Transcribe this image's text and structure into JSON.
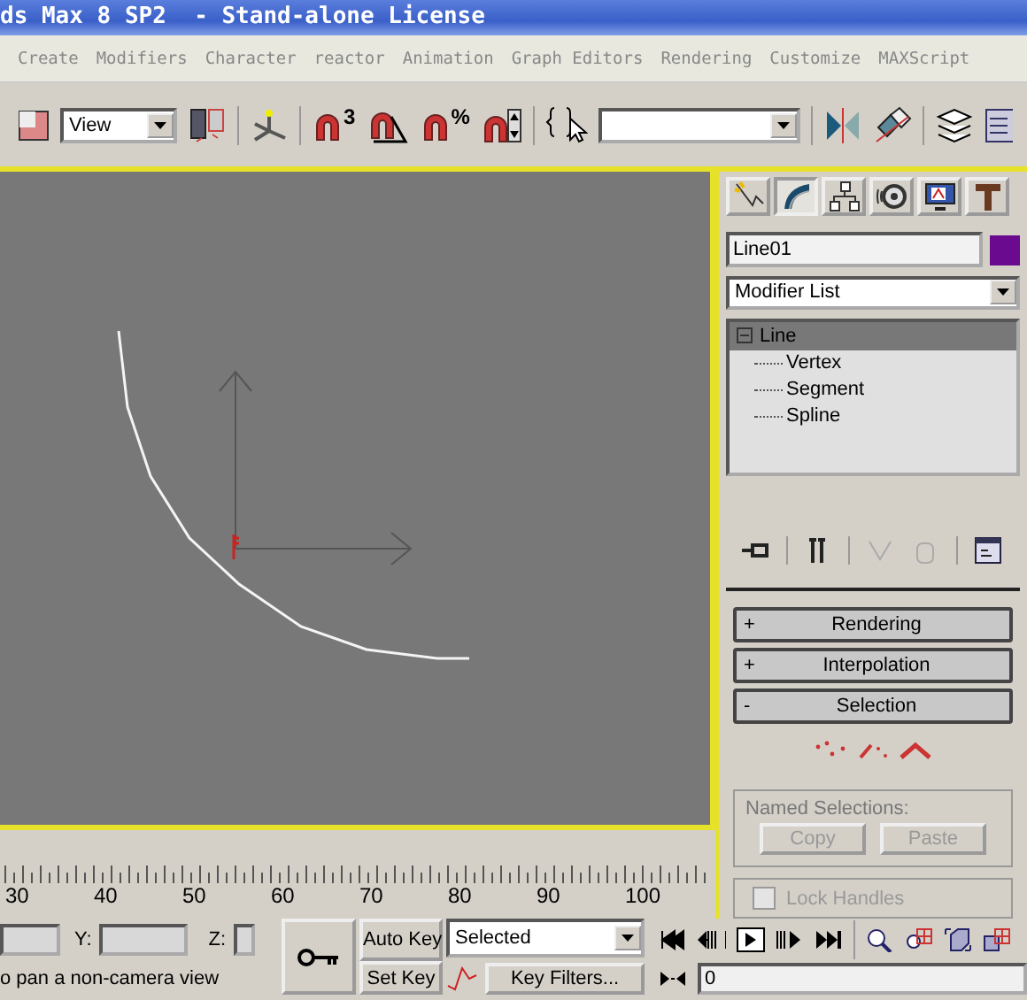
{
  "window": {
    "title": "ds Max 8 SP2  - Stand-alone License"
  },
  "menu": [
    "Create",
    "Modifiers",
    "Character",
    "reactor",
    "Animation",
    "Graph Editors",
    "Rendering",
    "Customize",
    "MAXScript"
  ],
  "toolbar": [
    {
      "kind": "select"
    },
    {
      "kind": "dropdown",
      "label": "View"
    },
    {
      "kind": "cards"
    },
    {
      "kind": "sep"
    },
    {
      "kind": "axes"
    },
    {
      "kind": "sep"
    },
    {
      "kind": "magnet",
      "glyph": "3"
    },
    {
      "kind": "angle"
    },
    {
      "kind": "magnet",
      "glyph": "%"
    },
    {
      "kind": "spinner"
    },
    {
      "kind": "sep"
    },
    {
      "kind": "braces"
    },
    {
      "kind": "dropdown"
    },
    {
      "kind": "sep"
    },
    {
      "kind": "mirror"
    },
    {
      "kind": "align"
    },
    {
      "kind": "sep"
    },
    {
      "kind": "layers"
    },
    {
      "kind": "panel"
    }
  ],
  "command_panel": {
    "tabs": [
      {
        "kind": "create",
        "selected": false
      },
      {
        "kind": "modify",
        "selected": true
      },
      {
        "kind": "hierarchy",
        "selected": false
      },
      {
        "kind": "motion",
        "selected": false
      },
      {
        "kind": "display",
        "selected": false
      },
      {
        "kind": "utilities",
        "selected": false
      }
    ],
    "object_name": "Line01",
    "modifier_list": "Modifier List",
    "stack": [
      {
        "label": "Line",
        "expanded": true,
        "selected": true,
        "children": [
          {
            "label": "Vertex"
          },
          {
            "label": "Segment"
          },
          {
            "label": "Spline"
          }
        ]
      }
    ],
    "stack_tools": [
      {
        "kind": "pin",
        "disabled": false
      },
      {
        "kind": "sep"
      },
      {
        "kind": "result",
        "disabled": false
      },
      {
        "kind": "sep"
      },
      {
        "kind": "unique",
        "disabled": true
      },
      {
        "kind": "remove",
        "disabled": true
      },
      {
        "kind": "sep"
      },
      {
        "kind": "configure",
        "disabled": false
      }
    ],
    "rollouts": [
      {
        "sign": "+",
        "title": "Rendering"
      },
      {
        "sign": "+",
        "title": "Interpolation"
      },
      {
        "sign": "-",
        "title": "Selection"
      }
    ],
    "selection": {
      "levels": [
        {
          "kind": "vertex",
          "selected": false
        },
        {
          "kind": "segment",
          "selected": false
        },
        {
          "kind": "spline",
          "selected": false
        }
      ],
      "named_selections": {
        "title": "Named Selections:",
        "buttons": [
          {
            "label": "Copy",
            "disabled": true
          },
          {
            "label": "Paste",
            "disabled": true
          }
        ]
      },
      "lock_handles": {
        "label": "Lock Handles",
        "checked": false,
        "disabled": true
      }
    }
  },
  "timeline": {
    "ticks": [
      "30",
      "40",
      "50",
      "60",
      "70",
      "80",
      "90",
      "100"
    ]
  },
  "coordinates": [
    {
      "label": "Y:"
    },
    {
      "label": "Z:"
    }
  ],
  "animation": {
    "auto_key": "Auto Key",
    "set_key": "Set Key",
    "key_mode": "Selected",
    "key_filters": "Key Filters...",
    "frame": "0"
  },
  "playback": [
    {
      "kind": "start"
    },
    {
      "kind": "prev"
    },
    {
      "kind": "play"
    },
    {
      "kind": "next"
    },
    {
      "kind": "end"
    }
  ],
  "navigation": [
    {
      "kind": "zoom"
    },
    {
      "kind": "zoom-all"
    },
    {
      "kind": "extents"
    },
    {
      "kind": "extents-all"
    }
  ],
  "status": "o pan a non-camera view"
}
